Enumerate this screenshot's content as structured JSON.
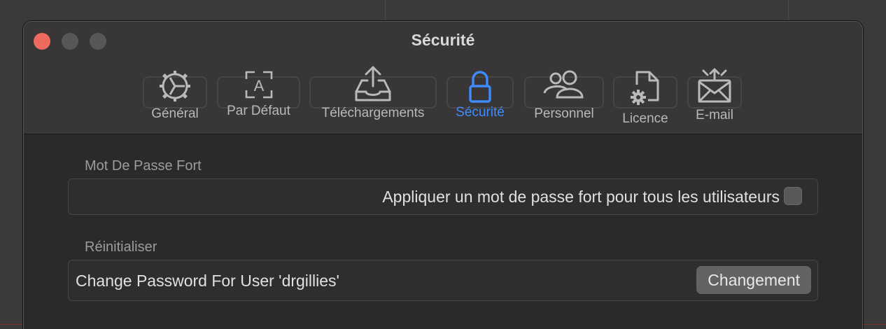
{
  "window": {
    "title": "Sécurité"
  },
  "tabs": [
    {
      "label": "Général",
      "icon": "gear-icon",
      "active": false
    },
    {
      "label": "Par Défaut",
      "icon": "text-frame-icon",
      "active": false
    },
    {
      "label": "Téléchargements",
      "icon": "tray-upload-icon",
      "active": false
    },
    {
      "label": "Sécurité",
      "icon": "lock-icon",
      "active": true
    },
    {
      "label": "Personnel",
      "icon": "people-icon",
      "active": false
    },
    {
      "label": "Licence",
      "icon": "document-gear-icon",
      "active": false
    },
    {
      "label": "E-mail",
      "icon": "envelope-icon",
      "active": false
    }
  ],
  "sections": {
    "strong_password": {
      "label": "Mot De Passe Fort",
      "checkbox_label": "Appliquer un mot de passe fort pour tous les utilisateurs",
      "checked": false
    },
    "reset": {
      "label": "Réinitialiser",
      "description": "Change Password For User 'drgillies'",
      "button_label": "Changement"
    }
  },
  "colors": {
    "accent": "#3f8cff",
    "close_button": "#ee6a5f"
  }
}
